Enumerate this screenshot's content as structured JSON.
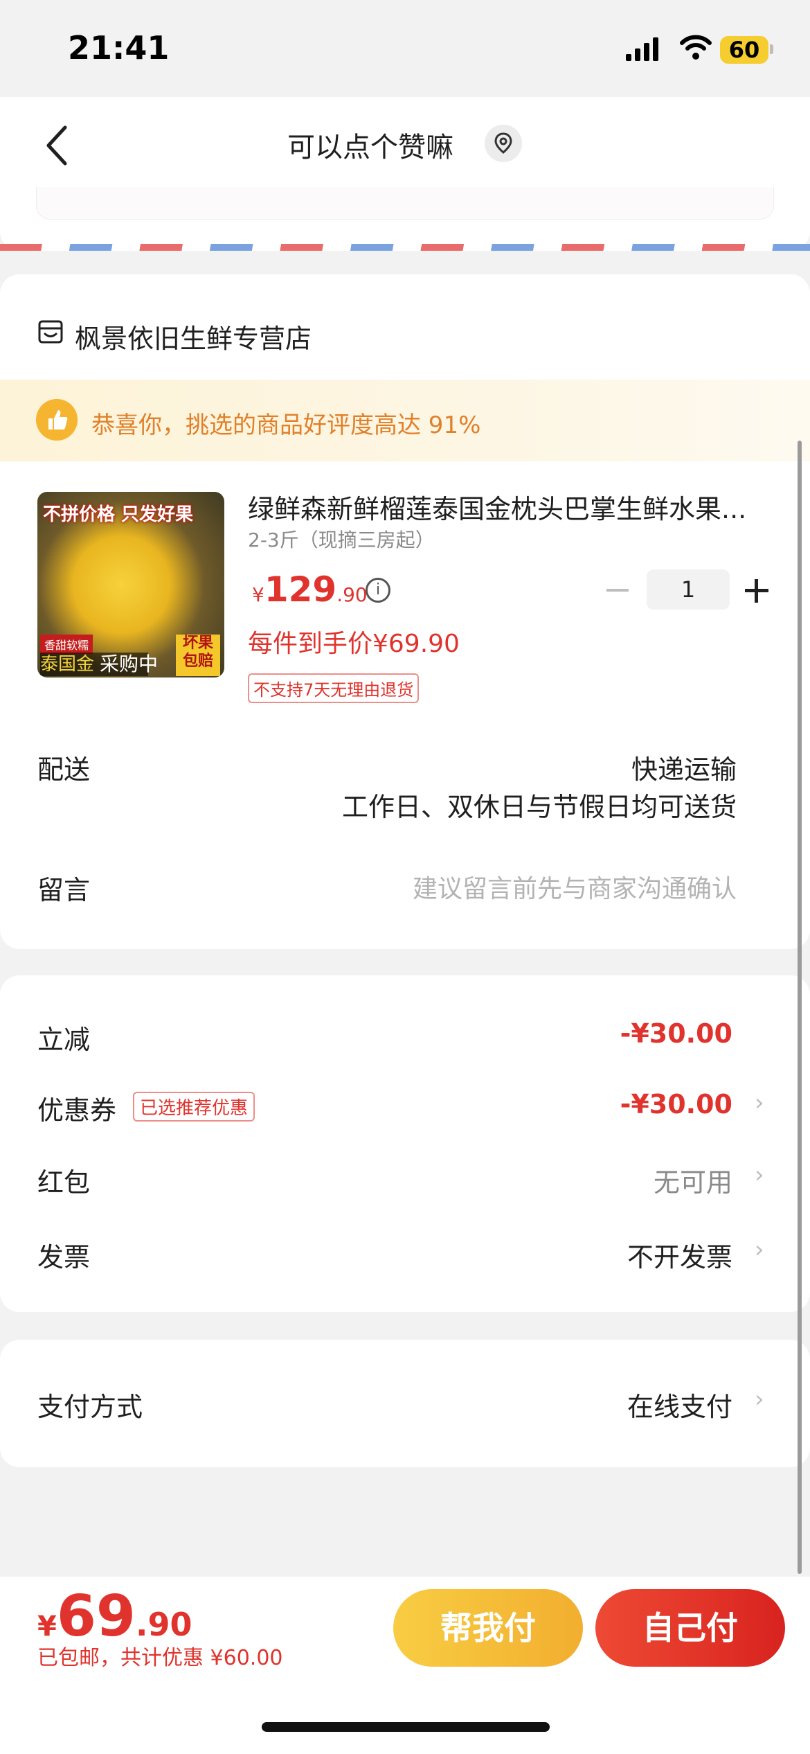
{
  "status_bar": {
    "time": "21:41",
    "battery": "60"
  },
  "nav": {
    "title": "可以点个赞嘛"
  },
  "shop": {
    "name": "枫景依旧生鲜专营店"
  },
  "praise": {
    "text": "恭喜你，挑选的商品好评度高达 91%"
  },
  "product": {
    "title": "绿鲜森新鲜榴莲泰国金枕头巴掌生鲜水果...",
    "spec": "2-3斤（现摘三房起）",
    "price_currency": "¥",
    "price_int": "129",
    "price_dec": ".90",
    "quantity": "1",
    "hand_price": "每件到手价¥69.90",
    "no_return": "不支持7天无理由退货",
    "thumb": {
      "banner": "不拼价格 只发好果",
      "tag1": "香甜软糯",
      "tag2": "泰国金",
      "overlay": "采购中",
      "tag3": "坏果包赔"
    }
  },
  "delivery": {
    "label": "配送",
    "method": "快递运输",
    "note": "工作日、双休日与节假日均可送货"
  },
  "memo": {
    "label": "留言",
    "placeholder": "建议留言前先与商家沟通确认"
  },
  "fees": {
    "discount_label": "立减",
    "discount_value": "-¥30.00",
    "coupon_label": "优惠券",
    "coupon_tag": "已选推荐优惠",
    "coupon_value": "-¥30.00",
    "redpacket_label": "红包",
    "redpacket_value": "无可用",
    "invoice_label": "发票",
    "invoice_value": "不开发票"
  },
  "payment": {
    "label": "支付方式",
    "value": "在线支付"
  },
  "bottom": {
    "currency": "¥",
    "total_int": "69",
    "total_dec": ".90",
    "subtitle": "已包邮，共计优惠 ¥60.00",
    "help_pay": "帮我付",
    "self_pay": "自己付"
  },
  "icons": {
    "back": "back-arrow-icon",
    "location": "location-pin-icon",
    "shop": "shop-icon",
    "thumbs_up": "thumbs-up-icon",
    "info": "info-icon",
    "chevron": "chevron-right-icon"
  },
  "colors": {
    "accent_red": "#e0332d",
    "accent_orange": "#e0802a",
    "help_pay_yellow": "#f5be3a"
  }
}
